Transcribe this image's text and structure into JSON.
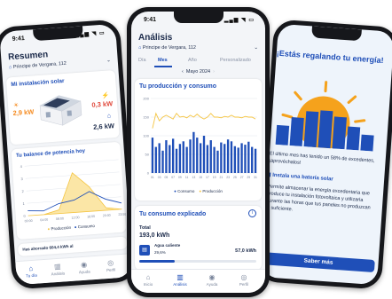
{
  "status": {
    "time": "9:41"
  },
  "left": {
    "title": "Resumen",
    "address": "Principe de Vergara, 112",
    "installation_title": "Mi instalación solar",
    "solar_kw": "2,9 kW",
    "grid_kw": "0,3 kW",
    "home_kw": "2,6 kW",
    "balance_title": "Tu balance de potencia hoy",
    "y_ticks": [
      "4",
      "3",
      "2",
      "1",
      "0"
    ],
    "x_ticks": [
      "00:00",
      "04:00",
      "08:00",
      "12:00",
      "16:00",
      "20:00",
      "23:59"
    ],
    "legend_production": "Producción",
    "legend_consumption": "Consumo",
    "teaser": "Has ahorrado 604,4 kWh al",
    "nav": [
      "Tu día",
      "Análisis",
      "Ayuda",
      "Perfil"
    ]
  },
  "center": {
    "title": "Análisis",
    "address": "Principe de Vergara, 112",
    "tabs": [
      "Día",
      "Mes",
      "Año",
      "Personalizado"
    ],
    "period": "Mayo 2024",
    "prod_cons_title": "Tu producción y consumo",
    "y_ticks": [
      "200",
      "150",
      "100",
      "50",
      "0"
    ],
    "x_ticks": [
      "01",
      "03",
      "05",
      "07",
      "09",
      "11",
      "13",
      "15",
      "17",
      "19",
      "21",
      "23",
      "25",
      "27",
      "29",
      "31"
    ],
    "legend_consumption": "Consumo",
    "legend_production": "Producción",
    "explained_title": "Tu consumo explicado",
    "total_label": "Total",
    "total_value": "193,0 kWh",
    "item_label": "Agua caliente",
    "item_percent": "29,6%",
    "item_value": "57,0 kWh",
    "nav": [
      "Inicio",
      "Análisis",
      "Ayuda",
      "Perfil"
    ]
  },
  "right": {
    "title": "¡Estás regalando tu energía!",
    "body": "El último mes has tenido un 58% de excedentes, ¡aprovéchalos!",
    "subtitle": "Instala una batería solar",
    "body2": "Permite almacenar la energía excedentaria que produce tu instalación fotovoltaica y utilizarla durante las horas que tus paneles no produzcan la suficiente.",
    "button": "Saber más"
  },
  "colors": {
    "accent": "#1f4fb8",
    "orange": "#f58a1f",
    "yellow": "#f5c542",
    "navy": "#1b2a4a"
  },
  "chart_data": [
    {
      "type": "area",
      "title": "Tu balance de potencia hoy",
      "x": [
        "00:00",
        "04:00",
        "08:00",
        "12:00",
        "16:00",
        "20:00",
        "23:59"
      ],
      "ylim": [
        0,
        4
      ],
      "series": [
        {
          "name": "Producción",
          "values": [
            0,
            0,
            0.3,
            3.2,
            2.0,
            0.2,
            0
          ]
        },
        {
          "name": "Consumo",
          "values": [
            0.4,
            0.3,
            0.8,
            1.0,
            1.6,
            0.9,
            0.5
          ]
        }
      ]
    },
    {
      "type": "bar",
      "title": "Tu producción y consumo",
      "ylim": [
        0,
        200
      ],
      "categories": [
        "01",
        "02",
        "03",
        "04",
        "05",
        "06",
        "07",
        "08",
        "09",
        "10",
        "11",
        "12",
        "13",
        "14",
        "15",
        "16",
        "17",
        "18",
        "19",
        "20",
        "21",
        "22",
        "23",
        "24",
        "25",
        "26",
        "27",
        "28",
        "29",
        "30",
        "31"
      ],
      "series": [
        {
          "name": "Consumo",
          "values": [
            95,
            70,
            80,
            60,
            88,
            75,
            92,
            65,
            78,
            85,
            70,
            90,
            110,
            95,
            80,
            100,
            75,
            88,
            70,
            60,
            82,
            78,
            90,
            85,
            72,
            68,
            80,
            76,
            84,
            70,
            65
          ]
        },
        {
          "name": "Producción",
          "values": [
            120,
            160,
            140,
            150,
            155,
            150,
            145,
            160,
            150,
            152,
            148,
            155,
            150,
            158,
            150,
            145,
            150,
            160,
            150,
            150,
            148,
            152,
            150,
            155,
            150,
            150,
            148,
            152,
            150,
            150,
            145
          ]
        }
      ]
    }
  ]
}
